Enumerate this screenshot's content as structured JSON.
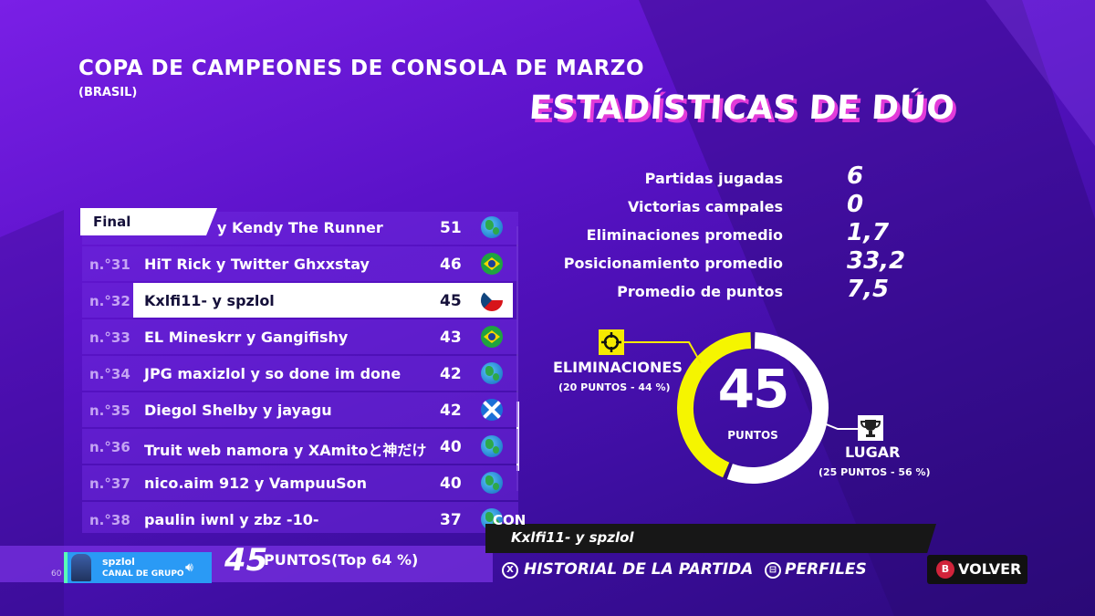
{
  "header": {
    "title": "COPA DE CAMPEONES DE CONSOLA DE MARZO",
    "subtitle": "(BRASIL)",
    "headline": "ESTADÍSTICAS DE DÚO"
  },
  "stats": [
    {
      "label": "Partidas jugadas",
      "value": "6"
    },
    {
      "label": "Victorias campales",
      "value": "0"
    },
    {
      "label": "Eliminaciones promedio",
      "value": "1,7"
    },
    {
      "label": "Posicionamiento promedio",
      "value": "33,2"
    },
    {
      "label": "Promedio de puntos",
      "value": "7,5"
    }
  ],
  "leaderboard": {
    "tab": "Final",
    "partial_top": {
      "name": "y Kendy The Runner",
      "points": "51",
      "flag": "world"
    },
    "rows": [
      {
        "rank": "n.°31",
        "name": "HiT Rick y Twitter Ghxxstay",
        "points": "46",
        "flag": "br",
        "selected": false
      },
      {
        "rank": "n.°32",
        "name": "Kxlfi11- y spzlol",
        "points": "45",
        "flag": "cz",
        "selected": true
      },
      {
        "rank": "n.°33",
        "name": "EL Mineskrr y Gangifishy",
        "points": "43",
        "flag": "br",
        "selected": false
      },
      {
        "rank": "n.°34",
        "name": "JPG maxizlol y so done im done",
        "points": "42",
        "flag": "world",
        "selected": false
      },
      {
        "rank": "n.°35",
        "name": "Diegol Shelby y jayagu",
        "points": "42",
        "flag": "sc",
        "selected": false
      },
      {
        "rank": "n.°36",
        "name": "Truit web namora y XAmitoと神だけ",
        "points": "40",
        "flag": "world",
        "selected": false
      },
      {
        "rank": "n.°37",
        "name": "nico.aim 912 y VampuuSon",
        "points": "40",
        "flag": "world",
        "selected": false
      },
      {
        "rank": "n.°38",
        "name": "paulin iwnl y zbz -10-",
        "points": "37",
        "flag": "world",
        "selected": false
      }
    ]
  },
  "donut": {
    "total": "45",
    "total_label": "PUNTOS",
    "elim_label": "ELIMINACIONES",
    "elim_sub": "(20 PUNTOS - 44 %)",
    "elim_fraction": 0.44,
    "place_label": "LUGAR",
    "place_sub": "(25 PUNTOS - 56 %)",
    "place_fraction": 0.56,
    "elim_color": "#f5f500",
    "place_color": "#ffffff"
  },
  "footer": {
    "total_points": "45",
    "total_label": "PUNTOS",
    "total_top": "(Top 64 %)",
    "with_label": "CON",
    "with_name": "Kxlfi11- y spzlol",
    "match_history": "HISTORIAL DE LA PARTIDA",
    "match_history_key": "X",
    "profiles": "PERFILES",
    "back": "VOLVER",
    "back_key": "B"
  },
  "party": {
    "name": "spzlol",
    "channel": "CANAL DE GRUPO",
    "fps": "60"
  }
}
